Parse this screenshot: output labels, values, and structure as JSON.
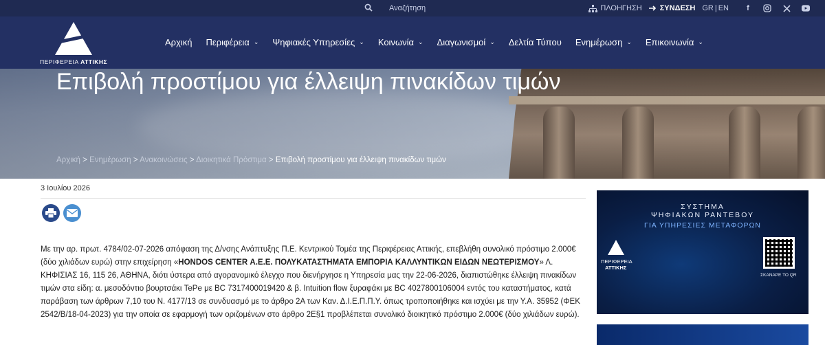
{
  "topbar": {
    "search_label": "Αναζήτηση",
    "nav_label": "ΠΛΟΗΓΗΣΗ",
    "login_label": "ΣΥΝΔΕΣΗ",
    "lang_gr": "GR",
    "lang_sep": "|",
    "lang_en": "EN",
    "social": [
      "facebook-icon",
      "instagram-icon",
      "x-icon",
      "youtube-icon"
    ]
  },
  "logo": {
    "prefix": "ΠΕΡΙΦΕΡΕΙΑ",
    "name": "ΑΤΤΙΚΗΣ"
  },
  "menu": [
    {
      "label": "Αρχική",
      "dropdown": false
    },
    {
      "label": "Περιφέρεια",
      "dropdown": true
    },
    {
      "label": "Ψηφιακές Υπηρεσίες",
      "dropdown": true
    },
    {
      "label": "Κοινωνία",
      "dropdown": true
    },
    {
      "label": "Διαγωνισμοί",
      "dropdown": true
    },
    {
      "label": "Δελτία Τύπου",
      "dropdown": false
    },
    {
      "label": "Ενημέρωση",
      "dropdown": true
    },
    {
      "label": "Επικοινωνία",
      "dropdown": true
    }
  ],
  "hero": {
    "title": "Επιβολή προστίμου για έλλειψη πινακίδων τιμών"
  },
  "breadcrumb": {
    "items": [
      "Αρχική",
      "Ενημέρωση",
      "Ανακοινώσεις",
      "Διοικητικά Πρόστιμα"
    ],
    "separator": " > ",
    "current": "Επιβολή προστίμου για έλλειψη πινακίδων τιμών"
  },
  "article": {
    "date": "3 Ιουλίου 2026",
    "p_before": "Με την αρ. πρωτ. 4784/02-07-2026 απόφαση της Δ/νσης Ανάπτυξης Π.Ε. Κεντρικού Τομέα της Περιφέρειας Αττικής, επεβλήθη συνολικό πρόστιμο 2.000€ (δύο χιλιάδων ευρώ) στην επιχείρηση «",
    "p_bold": "HONDOS CENTER Α.Ε.Ε. ΠΟΛΥΚΑΤΑΣΤΗΜΑΤΑ ΕΜΠΟΡΙΑ ΚΑΛΛΥΝΤΙΚΩΝ ΕΙΔΩΝ ΝΕΩΤΕΡΙΣΜΟΥ",
    "p_after": "» Λ. ΚΗΦΙΣΙΑΣ 16, 115 26, ΑΘΗΝΑ, διότι ύστερα από αγορανομικό έλεγχο που διενήργησε η Υπηρεσία μας την 22-06-2026, διαπιστώθηκε έλλειψη πινακίδων τιμών στα είδη: α. μεσοδόντιο βουρτσάκι TePe με BC 7317400019420 & β. Intuition flow ξυραφάκι με BC 4027800106004 εντός του καταστήματος, κατά παράβαση των άρθρων 7,10 του Ν. 4177/13 σε συνδυασμό με το άρθρο 2Α των Καν. Δ.Ι.Ε.Π.Π.Υ. όπως τροποποιήθηκε και ισχύει με την Υ.Α. 35952 (ΦΕΚ 2542/Β/18-04-2023) για την οποία σε εφαρμογή των οριζομένων στο άρθρο 2Ε§1 προβλέπεται συνολικό διοικητικό πρόστιμο 2.000€ (δύο χιλιάδων ευρώ)."
  },
  "ad": {
    "line1": "ΣΥΣΤΗΜΑ",
    "line2": "ΨΗΦΙΑΚΩΝ ΡΑΝΤΕΒΟΥ",
    "line3": "ΓΙΑ ΥΠΗΡΕΣΙΕΣ ΜΕΤΑΦΟΡΩΝ",
    "logo_prefix": "ΠΕΡΙΦΕΡΕΙΑ",
    "logo_name": "ΑΤΤΙΚΗΣ",
    "qr_label": "ΣΚΑΝΑΡΕ ΤΟ QR"
  },
  "colors": {
    "topbar": "#1f2a52",
    "navbar": "#233063",
    "print_icon": "#2a4a8a",
    "mail_icon": "#4a8fd0"
  }
}
